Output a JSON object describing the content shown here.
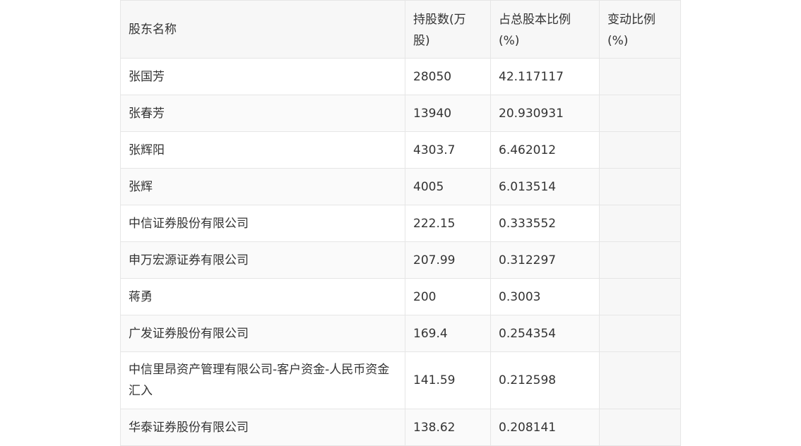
{
  "table": {
    "headers": {
      "name": "股东名称",
      "shares": "持股数(万股)",
      "ratio": "占总股本比例(%)",
      "change": "变动比例(%)"
    },
    "rows": [
      {
        "name": "张国芳",
        "shares": "28050",
        "ratio": "42.117117",
        "change": ""
      },
      {
        "name": "张春芳",
        "shares": "13940",
        "ratio": "20.930931",
        "change": ""
      },
      {
        "name": "张辉阳",
        "shares": "4303.7",
        "ratio": "6.462012",
        "change": ""
      },
      {
        "name": "张辉",
        "shares": "4005",
        "ratio": "6.013514",
        "change": ""
      },
      {
        "name": "中信证券股份有限公司",
        "shares": "222.15",
        "ratio": "0.333552",
        "change": ""
      },
      {
        "name": "申万宏源证券有限公司",
        "shares": "207.99",
        "ratio": "0.312297",
        "change": ""
      },
      {
        "name": "蒋勇",
        "shares": "200",
        "ratio": "0.3003",
        "change": ""
      },
      {
        "name": "广发证券股份有限公司",
        "shares": "169.4",
        "ratio": "0.254354",
        "change": ""
      },
      {
        "name": "中信里昂资产管理有限公司-客户资金-人民币资金汇入",
        "shares": "141.59",
        "ratio": "0.212598",
        "change": ""
      },
      {
        "name": "华泰证券股份有限公司",
        "shares": "138.62",
        "ratio": "0.208141",
        "change": ""
      }
    ]
  }
}
